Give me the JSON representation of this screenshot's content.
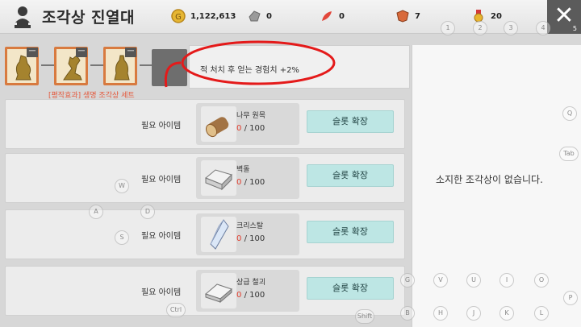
{
  "header": {
    "title": "조각상 진열대",
    "close_label": "✕",
    "close_hint": "5",
    "resources": [
      {
        "icon": "gold-coin-icon",
        "value": "1,122,613"
      },
      {
        "icon": "silver-gem-icon",
        "value": "0"
      },
      {
        "icon": "red-feather-icon",
        "value": "0"
      },
      {
        "icon": "shield-emblem-icon",
        "value": "7"
      },
      {
        "icon": "medal-icon",
        "value": "20"
      }
    ]
  },
  "statue_set": {
    "set_label": "[평작효과] 생명 조각상 세트",
    "bonus_text": "적 처치 후 얻는 경험치  +2%",
    "minus_label": "ㅡ"
  },
  "requirements": [
    {
      "label": "필요 아이템",
      "item_name": "나무 원목",
      "have": "0",
      "need": "/ 100",
      "button": "슬롯 확장",
      "icon": "wood-log-icon"
    },
    {
      "label": "필요 아이템",
      "item_name": "벽돌",
      "have": "0",
      "need": "/ 100",
      "button": "슬롯 확장",
      "icon": "brick-icon"
    },
    {
      "label": "필요 아이템",
      "item_name": "크리스탈",
      "have": "0",
      "need": "/ 100",
      "button": "슬롯 확장",
      "icon": "crystal-icon"
    },
    {
      "label": "필요 아이템",
      "item_name": "상급 철괴",
      "have": "0",
      "need": "/ 100",
      "button": "슬롯 확장",
      "icon": "iron-ingot-icon"
    }
  ],
  "right_panel": {
    "empty_message": "소지한 조각상이 없습니다."
  },
  "key_hints": [
    "1",
    "2",
    "3",
    "4",
    "Q",
    "Tab",
    "W",
    "A",
    "D",
    "S",
    "G",
    "V",
    "U",
    "I",
    "O",
    "P",
    "B",
    "H",
    "J",
    "K",
    "L",
    "Ctrl",
    "Shift"
  ],
  "colors": {
    "set_red": "#e4583b",
    "button_teal": "#bde6e4",
    "statue_border": "#d87a3f"
  }
}
